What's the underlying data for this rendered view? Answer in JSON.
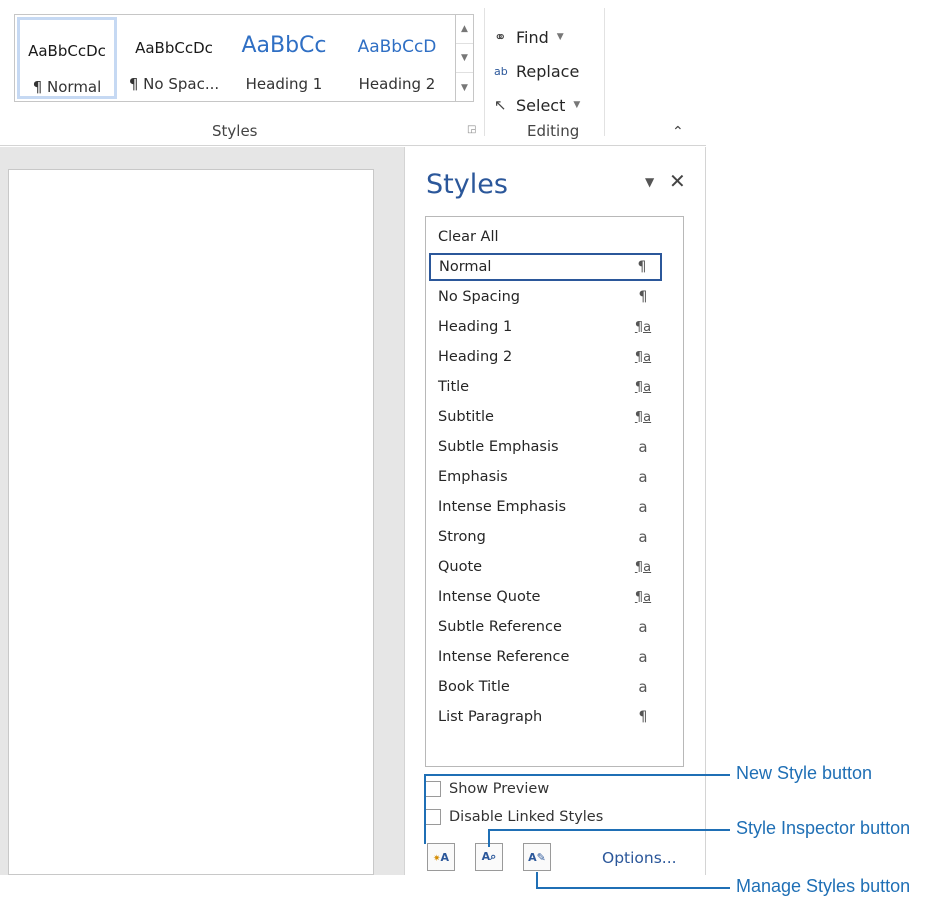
{
  "ribbon": {
    "styles_gallery": [
      {
        "sample": "AaBbCcDc",
        "label": "¶ Normal"
      },
      {
        "sample": "AaBbCcDc",
        "label": "¶ No Spac..."
      },
      {
        "sample": "AaBbCc",
        "label": "Heading 1"
      },
      {
        "sample": "AaBbCcD",
        "label": "Heading 2"
      }
    ],
    "styles_group_label": "Styles",
    "editing": {
      "find": "Find",
      "replace": "Replace",
      "select": "Select",
      "group_label": "Editing"
    }
  },
  "pane": {
    "title": "Styles",
    "styles": [
      {
        "name": "Clear All",
        "mark": ""
      },
      {
        "name": "Normal",
        "mark": "¶"
      },
      {
        "name": "No Spacing",
        "mark": "¶"
      },
      {
        "name": "Heading 1",
        "mark": "¶a"
      },
      {
        "name": "Heading 2",
        "mark": "¶a"
      },
      {
        "name": "Title",
        "mark": "¶a"
      },
      {
        "name": "Subtitle",
        "mark": "¶a"
      },
      {
        "name": "Subtle Emphasis",
        "mark": "a"
      },
      {
        "name": "Emphasis",
        "mark": "a"
      },
      {
        "name": "Intense Emphasis",
        "mark": "a"
      },
      {
        "name": "Strong",
        "mark": "a"
      },
      {
        "name": "Quote",
        "mark": "¶a"
      },
      {
        "name": "Intense Quote",
        "mark": "¶a"
      },
      {
        "name": "Subtle Reference",
        "mark": "a"
      },
      {
        "name": "Intense Reference",
        "mark": "a"
      },
      {
        "name": "Book Title",
        "mark": "a"
      },
      {
        "name": "List Paragraph",
        "mark": "¶"
      }
    ],
    "selected_style": "Normal",
    "show_preview": "Show Preview",
    "disable_linked_styles": "Disable Linked Styles",
    "options_link": "Options..."
  },
  "callouts": {
    "new_style": "New Style button",
    "style_inspector": "Style Inspector button",
    "manage_styles": "Manage Styles button"
  },
  "accent_color": "#2b579a",
  "callout_color": "#1f6fb5"
}
